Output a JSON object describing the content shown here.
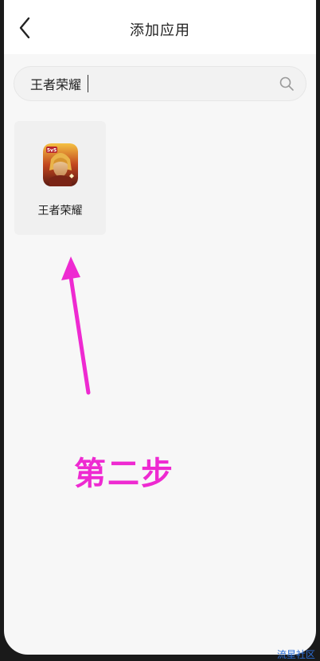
{
  "header": {
    "title": "添加应用",
    "back_icon": "chevron-left-icon"
  },
  "search": {
    "value": "王者荣耀",
    "placeholder": "",
    "icon": "search-icon"
  },
  "results": [
    {
      "name": "王者荣耀",
      "icon": "game-app-icon"
    }
  ],
  "annotation": {
    "text": "第二步",
    "color": "#ee2ad1"
  },
  "watermark": "流星社区"
}
